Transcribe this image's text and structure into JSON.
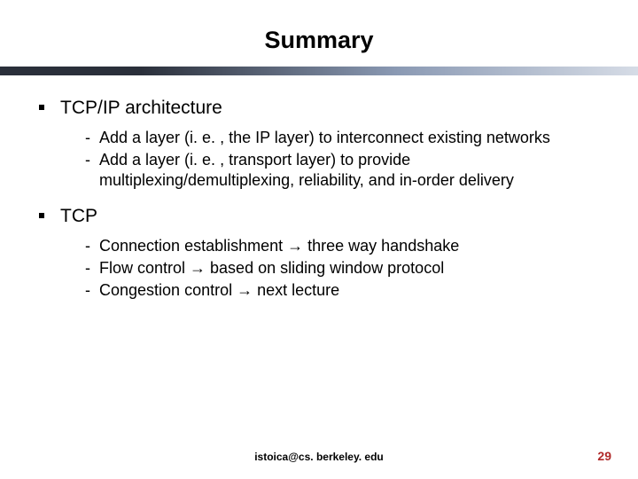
{
  "title": "Summary",
  "bullets": [
    {
      "label": "TCP/IP architecture",
      "sub": [
        "Add a layer (i. e. , the IP layer) to interconnect existing networks",
        "Add a layer (i. e. , transport layer) to provide multiplexing/demultiplexing, reliability, and in-order delivery"
      ]
    },
    {
      "label": "TCP",
      "sub": [
        "Connection establishment → three way handshake",
        "Flow control → based on sliding window protocol",
        "Congestion control → next lecture"
      ]
    }
  ],
  "footer": {
    "email": "istoica@cs. berkeley. edu",
    "page": "29"
  }
}
